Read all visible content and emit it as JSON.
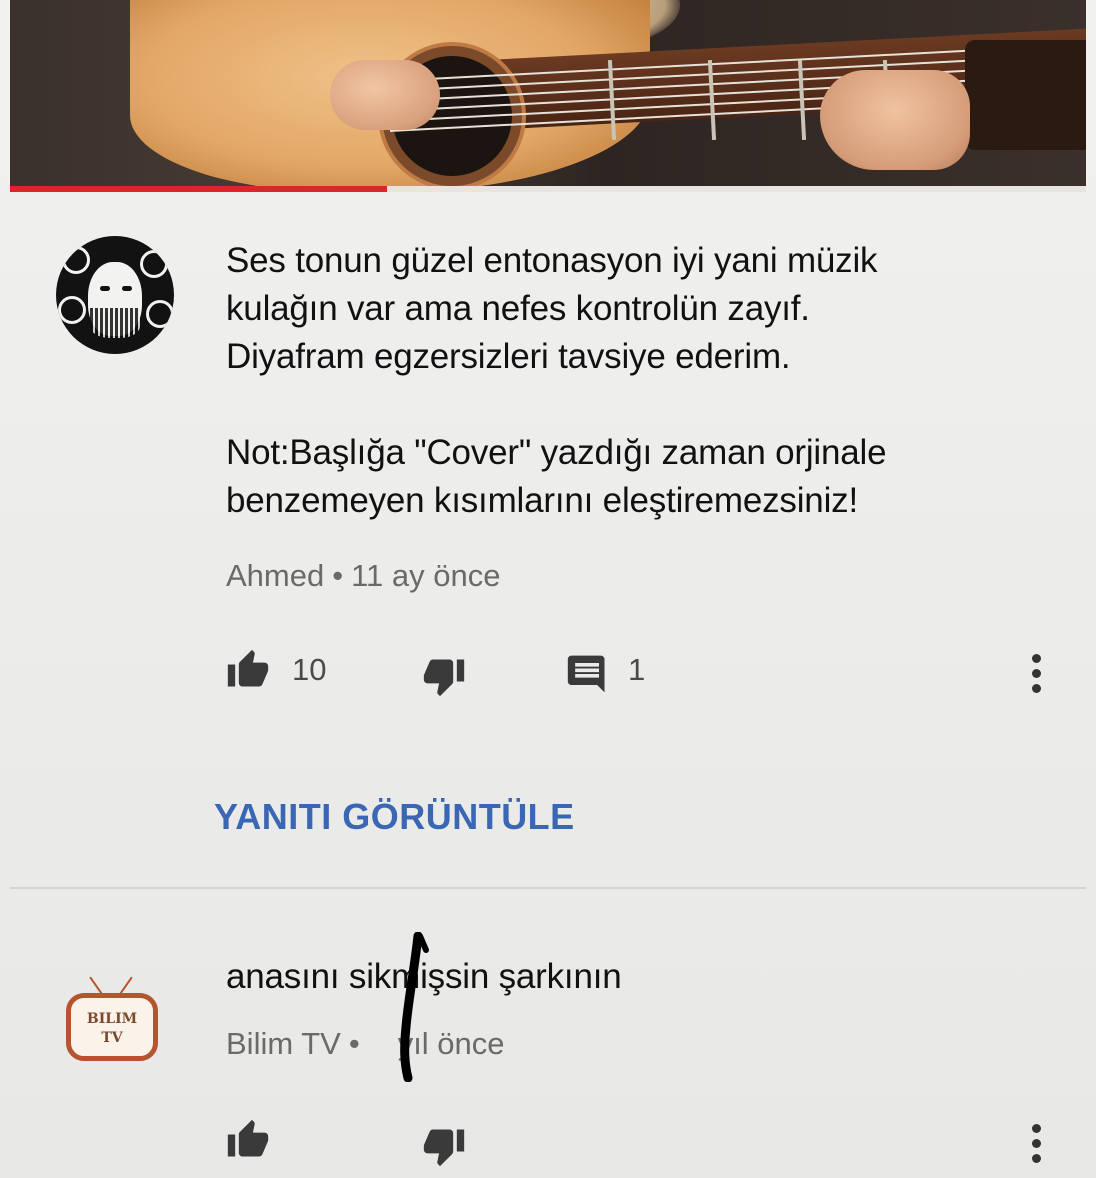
{
  "video": {
    "progress_percent": 35
  },
  "comments": [
    {
      "author": "Ahmed",
      "separator": "•",
      "time": "11 ay önce",
      "lines": [
        "Ses tonun güzel entonasyon iyi yani müzik",
        "kulağın var ama nefes kontrolün zayıf.",
        "Diyafram egzersizleri tavsiye ederim.",
        "",
        "Not:Başlığa \"Cover\" yazdığı zaman orjinale",
        "benzemeyen kısımlarını eleştiremezsiniz!"
      ],
      "likes": "10",
      "replies": "1",
      "reply_link": "YANITI GÖRÜNTÜLE"
    },
    {
      "author": "Bilim TV",
      "separator": "•",
      "time": "yıl önce",
      "avatar_text_1": "BILIM",
      "avatar_text_2": "TV",
      "lines": [
        "anasını sikmişsin şarkının"
      ]
    }
  ],
  "icons": {
    "like": "thumbs-up-icon",
    "dislike": "thumbs-down-icon",
    "reply": "comment-icon",
    "more": "more-vertical-icon"
  },
  "colors": {
    "accent_blue": "#3a67b4",
    "progress_red": "#d8262a"
  }
}
